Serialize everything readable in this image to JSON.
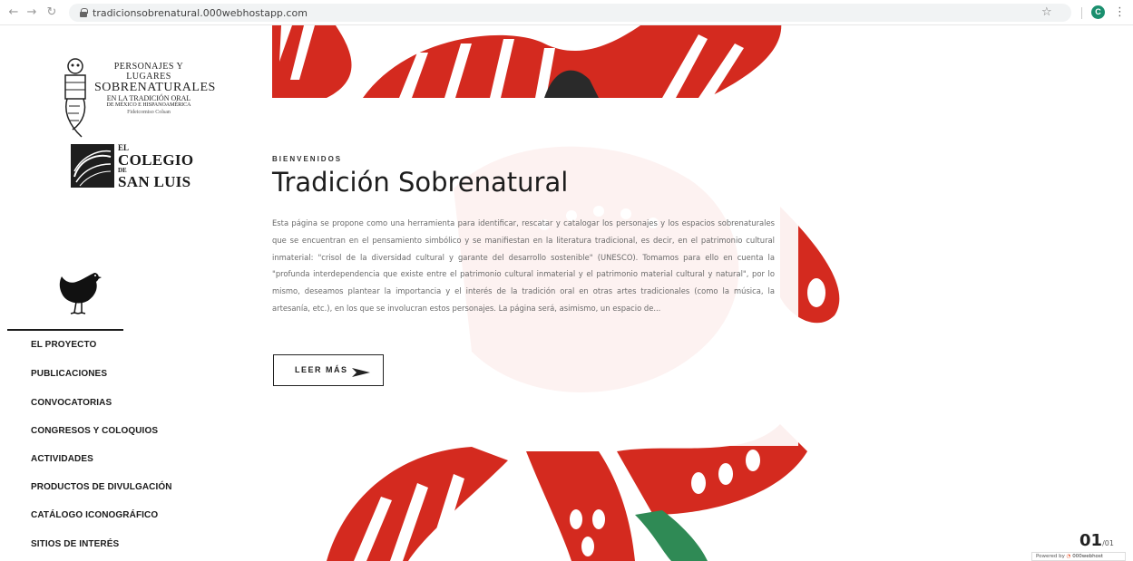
{
  "browser": {
    "url": "tradicionsobrenatural.000webhostapp.com",
    "profile_initial": "C"
  },
  "logos": {
    "project": {
      "line1": "PERSONAJES Y LUGARES",
      "line2": "SOBRENATURALES",
      "line3": "EN LA TRADICIÓN ORAL",
      "line4": "DE MÉXICO E HISPANOAMÉRICA",
      "line5": "Fideicomiso Colsan"
    },
    "colegio": {
      "el": "EL",
      "colegio": "COLEGIO",
      "de": "DE",
      "san_luis": "SAN LUIS"
    }
  },
  "menu": {
    "items": [
      {
        "label": "EL PROYECTO",
        "active": true
      },
      {
        "label": "PUBLICACIONES"
      },
      {
        "label": "CONVOCATORIAS"
      },
      {
        "label": "CONGRESOS Y COLOQUIOS"
      },
      {
        "label": "ACTIVIDADES"
      },
      {
        "label": "PRODUCTOS DE DIVULGACIÓN"
      },
      {
        "label": "CATÁLOGO ICONOGRÁFICO"
      },
      {
        "label": "SITIOS DE INTERÉS"
      }
    ]
  },
  "hero": {
    "kicker": "BIENVENIDOS",
    "title": "Tradición Sobrenatural",
    "body": "Esta página se propone como una herramienta para identificar, rescatar y catalogar los personajes y los espacios sobrenaturales que se encuentran en el pensamiento simbólico y se manifiestan en la literatura tradicional, es decir, en el patrimonio cultural inmaterial: \"crisol de la diversidad cultural y garante del desarrollo sostenible\" (UNESCO). Tomamos para ello en cuenta la \"profunda interdependencia que existe entre el patrimonio cultural inmaterial y el patrimonio material cultural y natural\", por lo mismo, deseamos plantear la importancia y el interés de la tradición oral en otras artes tradicionales (como la música, la artesanía, etc.), en los que se involucran estos personajes. La página será, asimismo, un espacio de...",
    "button_label": "LEER MÁS"
  },
  "pager": {
    "current": "01",
    "total": "/01"
  },
  "footer": {
    "powered_by": "Powered by",
    "brand": "000webhost"
  },
  "colors": {
    "accent_red": "#d42a1f",
    "text_dark": "#1d1d1d",
    "body_gray": "#6a6a6a"
  }
}
